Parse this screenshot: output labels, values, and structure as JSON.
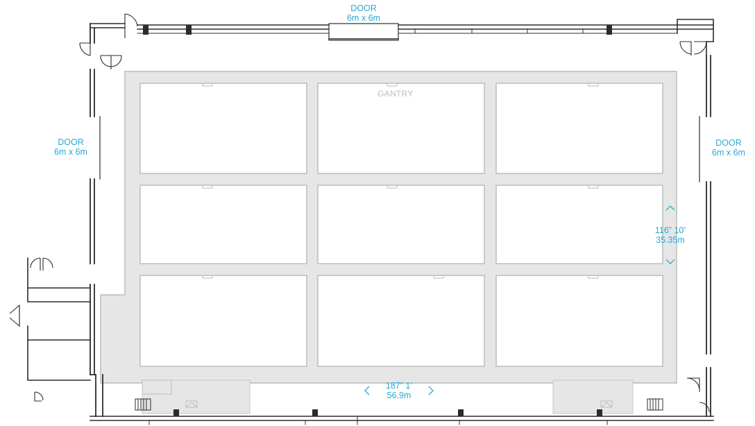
{
  "labels": {
    "top_door": {
      "name": "DOOR",
      "size": "6m x 6m"
    },
    "left_door": {
      "name": "DOOR",
      "size": "6m x 6m"
    },
    "right_door": {
      "name": "DOOR",
      "size": "6m x 6m"
    },
    "gantry": "GANTRY",
    "height_dim": {
      "imperial": "116” 10’",
      "metric": "35.35m"
    },
    "width_dim": {
      "imperial": "187” 1’",
      "metric": "56.9m"
    }
  },
  "colors": {
    "wall": "#2b2b2b",
    "gantry_fill": "#e6e6e6",
    "bay_outline": "#bdbdbd",
    "annotation": "#29a9d6"
  },
  "grid": {
    "rows": 3,
    "columns": 3
  }
}
